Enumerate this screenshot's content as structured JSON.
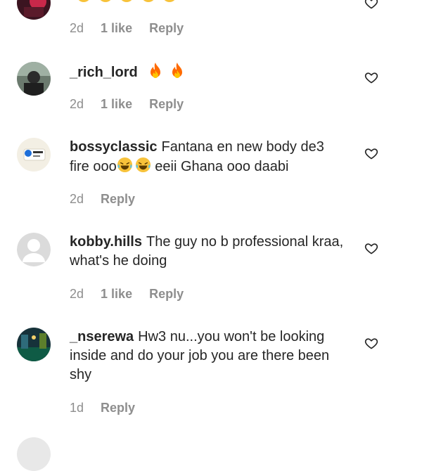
{
  "comments": [
    {
      "username": "",
      "text": "",
      "time": "2d",
      "likes": "1 like",
      "reply": "Reply"
    },
    {
      "username": "_rich_lord",
      "text": "",
      "emojis": [
        "fire",
        "fire"
      ],
      "time": "2d",
      "likes": "1 like",
      "reply": "Reply"
    },
    {
      "username": "bossyclassic",
      "text_part1": "Fantana en new body de3 fire ooo",
      "emojis": [
        "laughing",
        "laughing"
      ],
      "text_part2": " eeii Ghana ooo daabi",
      "time": "2d",
      "reply": "Reply"
    },
    {
      "username": "kobby.hills",
      "text": "The guy no b professional kraa, what's he doing",
      "time": "2d",
      "likes": "1 like",
      "reply": "Reply"
    },
    {
      "username": "_nserewa",
      "text": "Hw3 nu...you won't be looking inside and do your job you are there been shy",
      "time": "1d",
      "reply": "Reply"
    }
  ],
  "colors": {
    "text": "#262626",
    "meta": "#8e8e8e",
    "fire": "#ff6a00",
    "laugh": "#f7c23a"
  },
  "icons": [
    "heart-icon",
    "fire-emoji",
    "laughing-emoji",
    "avatar"
  ]
}
